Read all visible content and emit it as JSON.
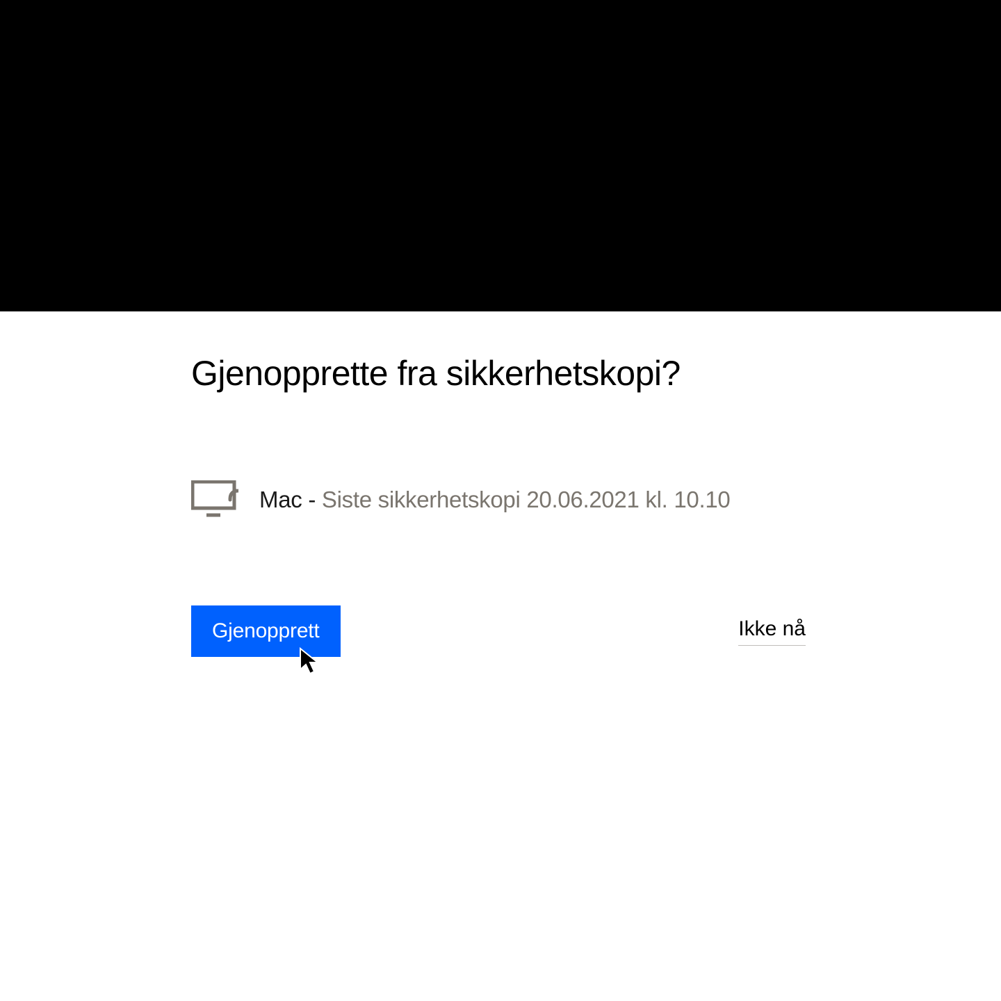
{
  "dialog": {
    "title": "Gjenopprette fra sikkerhetskopi?",
    "backup": {
      "device": "Mac",
      "separator": " - ",
      "detail": "Siste sikkerhetskopi 20.06.2021 kl. 10.10"
    },
    "actions": {
      "restore": "Gjenopprett",
      "not_now": "Ikke nå"
    }
  }
}
